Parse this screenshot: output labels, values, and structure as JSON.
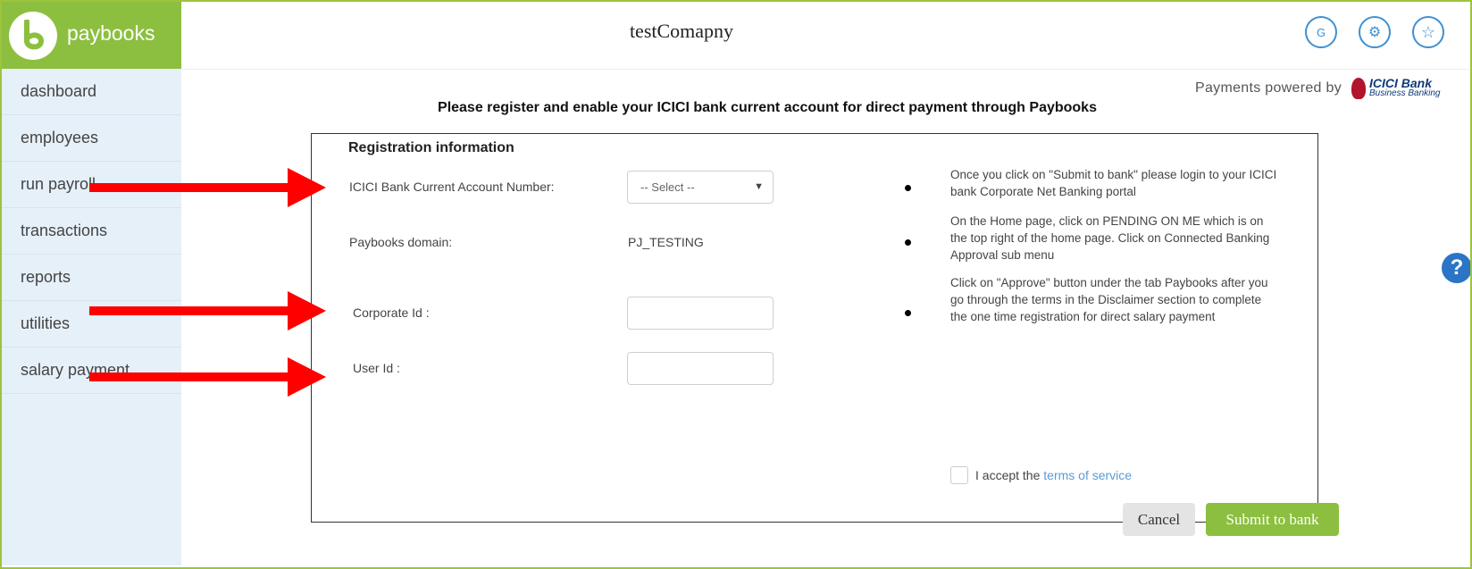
{
  "brand": {
    "name": "paybooks",
    "color": "#8cbf3f"
  },
  "sidebar": {
    "items": [
      {
        "label": "dashboard"
      },
      {
        "label": "employees"
      },
      {
        "label": "run payroll"
      },
      {
        "label": "transactions"
      },
      {
        "label": "reports"
      },
      {
        "label": "utilities"
      },
      {
        "label": "salary payment"
      }
    ]
  },
  "header": {
    "company": "testComapny",
    "buttons": [
      {
        "icon": "user-initial-icon",
        "label": "G"
      },
      {
        "icon": "gear-icon",
        "label": "⚙"
      },
      {
        "icon": "star-icon",
        "label": "☆"
      }
    ]
  },
  "powered": {
    "text": "Payments powered by",
    "bank_name": "ICICI Bank",
    "bank_sub": "Business Banking"
  },
  "heading": "Please register and enable your ICICI bank current account for direct payment through Paybooks",
  "form": {
    "section_title": "Registration information",
    "account_label": "ICICI Bank Current Account Number:",
    "account_select": "-- Select --",
    "domain_label": "Paybooks domain:",
    "domain_value": "PJ_TESTING",
    "corporate_label": "Corporate Id :",
    "corporate_value": "",
    "user_label": "User Id :",
    "user_value": ""
  },
  "instructions": [
    "Once you click on \"Submit to bank\" please login to your ICICI bank Corporate Net Banking portal",
    "On the Home page, click on PENDING ON ME which is on the top right of the home page. Click on Connected Banking Approval sub menu",
    "Click on \"Approve\" button under the tab Paybooks after you go through the terms in the Disclaimer section to complete the one time registration for direct salary payment"
  ],
  "terms": {
    "prefix": "I accept the",
    "link": "terms of service",
    "checked": false
  },
  "buttons": {
    "cancel": "Cancel",
    "submit": "Submit to bank"
  },
  "help": {
    "label": "?"
  },
  "colors": {
    "accent": "#8cbf3f",
    "arrow": "#ff0000",
    "link": "#5b9bd5",
    "icon_blue": "#3f90d2"
  }
}
